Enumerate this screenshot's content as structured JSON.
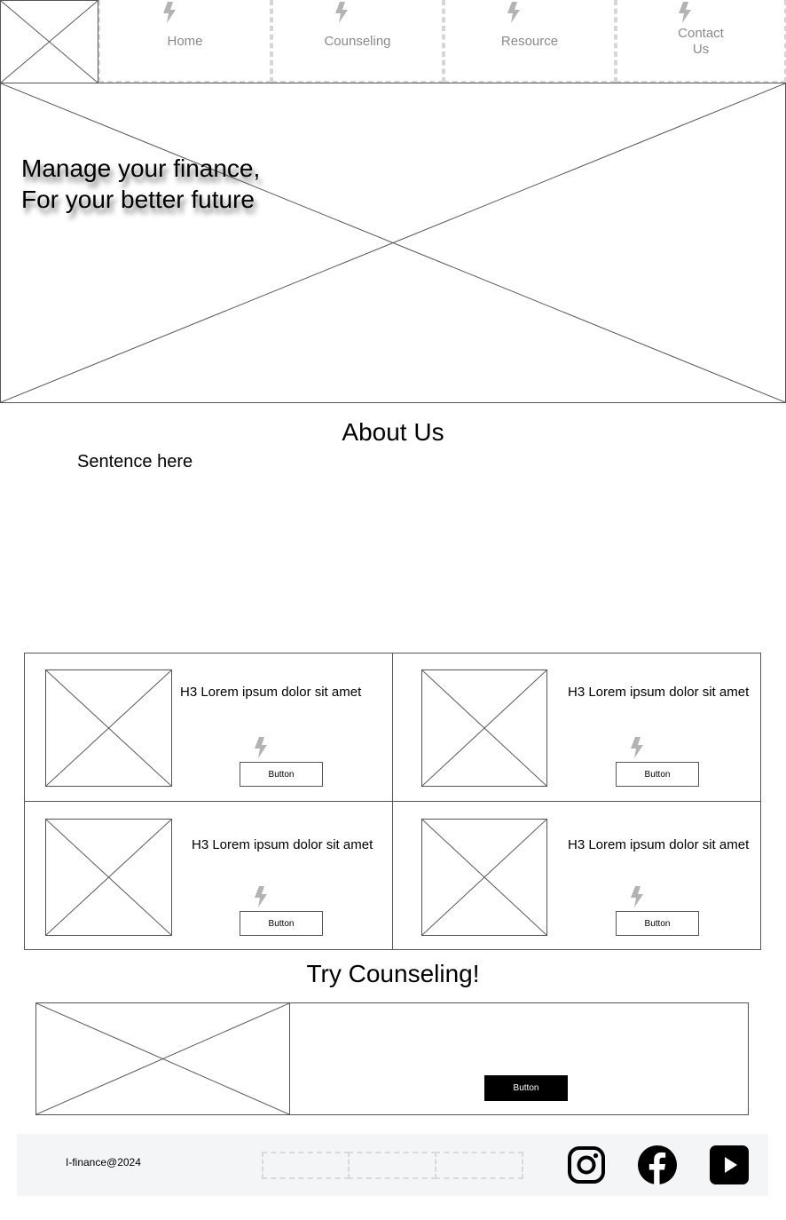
{
  "nav": {
    "items": [
      {
        "label": "Home",
        "icon": "lightning-icon"
      },
      {
        "label": "Counseling",
        "icon": "lightning-icon"
      },
      {
        "label": "Resource",
        "icon": "lightning-icon"
      },
      {
        "label": "Contact Us",
        "icon": "lightning-icon"
      }
    ]
  },
  "hero": {
    "line1": "Manage your finance,",
    "line2": "For your better future"
  },
  "about": {
    "title": "About Us",
    "sentence": "Sentence here"
  },
  "cards": [
    {
      "title": "H3 Lorem ipsum dolor sit amet",
      "button": "Button"
    },
    {
      "title": "H3 Lorem ipsum dolor sit amet",
      "button": "Button"
    },
    {
      "title": "H3 Lorem ipsum dolor sit amet",
      "button": "Button"
    },
    {
      "title": "H3 Lorem ipsum dolor sit amet",
      "button": "Button"
    }
  ],
  "counseling": {
    "title": "Try Counseling!",
    "button": "Button"
  },
  "footer": {
    "copyright": "I-finance@2024",
    "social": [
      "instagram-icon",
      "facebook-icon",
      "youtube-icon"
    ]
  },
  "colors": {
    "icon_gray": "#b3b3b3",
    "nav_text": "#8a8a8a",
    "footer_bg": "#f4f5f7",
    "primary_button": "#000000"
  }
}
